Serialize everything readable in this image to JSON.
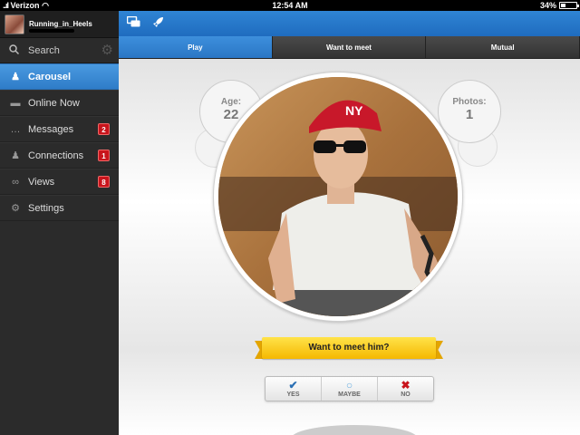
{
  "status_bar": {
    "carrier": "Verizon",
    "time": "12:54 AM",
    "battery": "34%",
    "battery_level": 0.34
  },
  "sidebar": {
    "username": "Running_in_Heels",
    "search_label": "Search",
    "items": [
      {
        "label": "Carousel",
        "icon": "carousel-icon",
        "badge": ""
      },
      {
        "label": "Online Now",
        "icon": "chat-icon",
        "badge": ""
      },
      {
        "label": "Messages",
        "icon": "message-icon",
        "badge": "2"
      },
      {
        "label": "Connections",
        "icon": "people-icon",
        "badge": "1"
      },
      {
        "label": "Views",
        "icon": "glasses-icon",
        "badge": "8"
      },
      {
        "label": "Settings",
        "icon": "gears-icon",
        "badge": ""
      }
    ]
  },
  "tabs": [
    {
      "label": "Play"
    },
    {
      "label": "Want to meet"
    },
    {
      "label": "Mutual"
    }
  ],
  "profile_card": {
    "age_label": "Age:",
    "age_value": "22",
    "photos_label": "Photos:",
    "photos_value": "1",
    "prompt": "Want to meet him?"
  },
  "choices": {
    "yes": "YES",
    "maybe": "MAYBE",
    "no": "NO"
  },
  "colors": {
    "accent": "#2f84d4",
    "badge": "#c8141c",
    "ribbon": "#f5b800",
    "yes": "#2a6fb4",
    "maybe": "#6aaee0",
    "no": "#c8141c"
  }
}
